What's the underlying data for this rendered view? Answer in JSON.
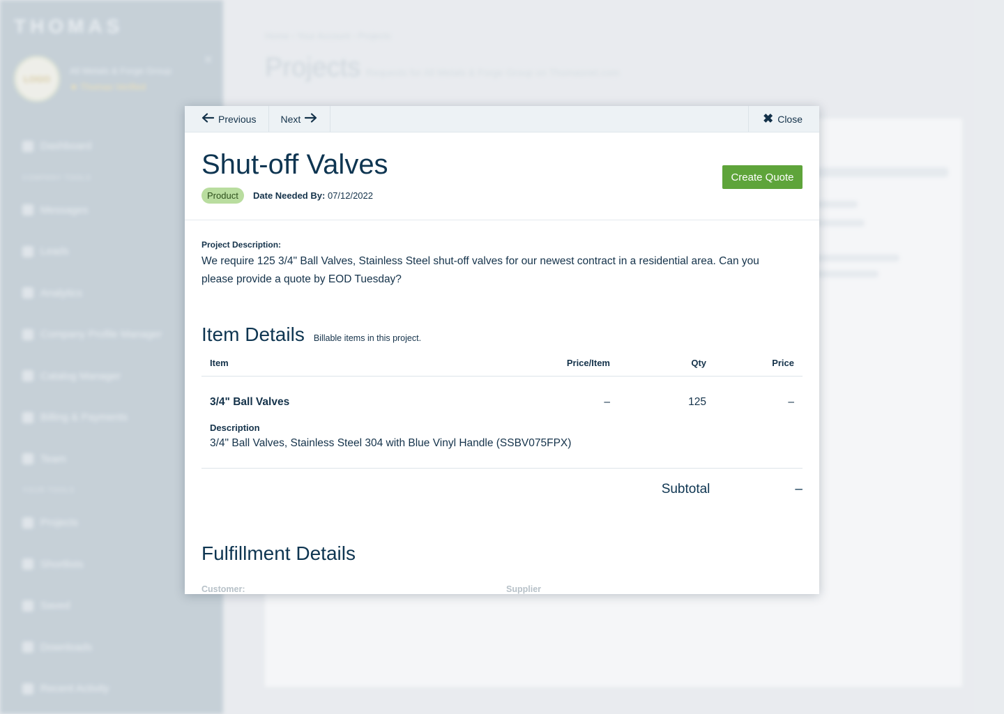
{
  "background": {
    "logo": "THOMAS",
    "account": {
      "avatar_text": "LOGO",
      "name": "All Metals & Forge Group",
      "badge": "★ Thomas Verified"
    },
    "nav_items": [
      {
        "icon": "dashboard-icon",
        "label": "Dashboard"
      },
      {
        "section": "Company Tools"
      },
      {
        "icon": "messages-icon",
        "label": "Messages"
      },
      {
        "icon": "leads-icon",
        "label": "Leads"
      },
      {
        "icon": "analytics-icon",
        "label": "Analytics"
      },
      {
        "icon": "company-profile-icon",
        "label": "Company Profile Manager"
      },
      {
        "icon": "catalog-icon",
        "label": "Catalog Manager"
      },
      {
        "icon": "billing-icon",
        "label": "Billing & Payments"
      },
      {
        "icon": "team-icon",
        "label": "Team"
      },
      {
        "section": "Your Tools"
      },
      {
        "icon": "projects-icon",
        "label": "Projects"
      },
      {
        "icon": "shortlists-icon",
        "label": "Shortlists"
      },
      {
        "icon": "saved-icon",
        "label": "Saved"
      },
      {
        "icon": "downloads-icon",
        "label": "Downloads"
      },
      {
        "icon": "recent-activity-icon",
        "label": "Recent Activity"
      }
    ],
    "breadcrumb": "Home  ›  Your Account  ›  Projects",
    "page_title": "Projects",
    "page_subtitle": "Requests for All Metals & Forge Group on Thomasnet.com"
  },
  "modal": {
    "nav": {
      "previous": "Previous",
      "next": "Next",
      "close": "Close"
    },
    "title": "Shut-off Valves",
    "tag": "Product",
    "date_label": "Date Needed By:",
    "date_value": "07/12/2022",
    "create_quote": "Create Quote",
    "description_label": "Project Description:",
    "description_text": "We require 125 3/4\" Ball Valves,  Stainless Steel shut-off valves for our newest contract in a residential area. Can you please provide a quote by EOD Tuesday?",
    "item_details": {
      "title": "Item Details",
      "subtitle": "Billable items in this project.",
      "columns": [
        "Item",
        "Price/Item",
        "Qty",
        "Price"
      ],
      "rows": [
        {
          "item": "3/4\" Ball Valves",
          "price_per_item": "–",
          "qty": "125",
          "price": "–",
          "description_label": "Description",
          "description": "3/4\" Ball Valves, Stainless Steel 304 with Blue Vinyl Handle (SSBV075FPX)"
        }
      ],
      "subtotal_label": "Subtotal",
      "subtotal_value": "–"
    },
    "fulfillment": {
      "title": "Fulfillment Details",
      "customer_label": "Customer:",
      "supplier_label": "Supplier"
    }
  }
}
